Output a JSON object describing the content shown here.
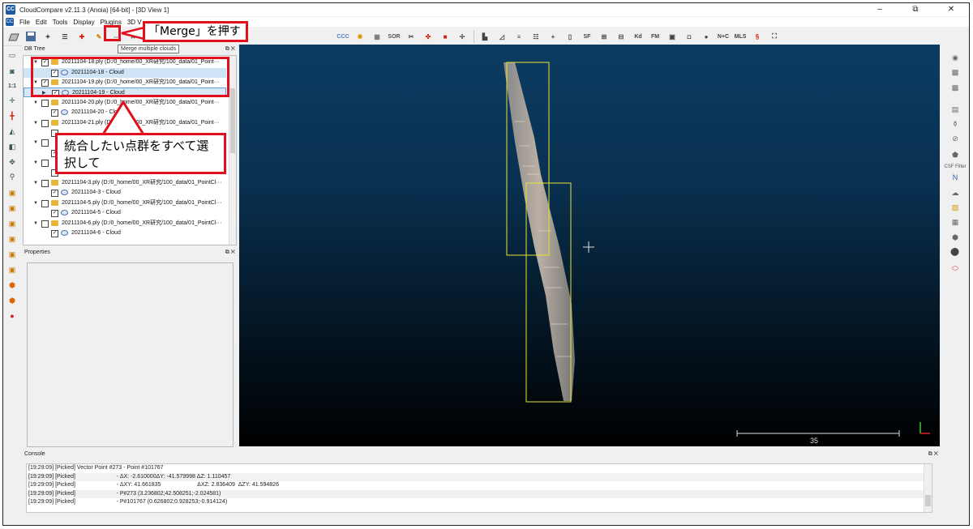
{
  "window": {
    "title": "CloudCompare v2.11.3 (Anoia) [64-bit] - [3D View 1]",
    "controls": [
      "–",
      "⧉",
      "✕"
    ]
  },
  "menu": {
    "items": [
      "File",
      "Edit",
      "Tools",
      "Display",
      "Plugins",
      "3D V"
    ]
  },
  "toolbar": {
    "tooltip": "Merge multiple clouds",
    "callout": "「Merge」を押す",
    "sor_label": "SOR",
    "sf_label": "SF",
    "kd_label": "Kd",
    "fm_label": "FM",
    "nc_label": "N+C",
    "mls_label": "MLS",
    "ccc_label": "CCC"
  },
  "db_tree": {
    "title": "DB Tree",
    "callout": "統合したい点群をすべて選択して",
    "rows": [
      {
        "text": "20211104-18.ply (D:/0_home/00_XR研究/100_data/01_Point···",
        "kind": "folder"
      },
      {
        "text": "20211104-18 - Cloud",
        "kind": "cloud"
      },
      {
        "text": "20211104-19.ply (D:/0_home/00_XR研究/100_data/01_Point···",
        "kind": "folder"
      },
      {
        "text": "20211104-19 - Cloud",
        "kind": "cloud"
      },
      {
        "text": "20211104-20.ply (D:/0_home/00_XR研究/100_data/01_Point···",
        "kind": "folder"
      },
      {
        "text": "20211104-20 - Cloud",
        "kind": "cloud"
      },
      {
        "text": "20211104-21.ply (D:/0_home/00_XR研究/100_data/01_Point···",
        "kind": "folder"
      },
      {
        "text": "20211104-3.ply (D:/0_home/00_XR研究/100_data/01_PointCl···",
        "kind": "folder"
      },
      {
        "text": "20211104-3 - Cloud",
        "kind": "cloud"
      },
      {
        "text": "20211104-5.ply (D:/0_home/00_XR研究/100_data/01_PointCl···",
        "kind": "folder"
      },
      {
        "text": "20211104-5 - Cloud",
        "kind": "cloud"
      },
      {
        "text": "20211104-6.ply (D:/0_home/00_XR研究/100_data/01_PointCl···",
        "kind": "folder"
      },
      {
        "text": "20211104-6 - Cloud",
        "kind": "cloud"
      }
    ]
  },
  "properties": {
    "title": "Properties"
  },
  "view3d": {
    "scale_label": "35"
  },
  "right_tools": {
    "csf_label": "CSF Filter"
  },
  "console": {
    "title": "Console",
    "lines": [
      "[19:29:09] [Picked] Vector Point #273 - Point #101767",
      "[19:29:09] [Picked]                          - ΔX: -2.610000ΔY: -41.579998 ΔZ: 1.110457",
      "[19:29:09] [Picked]                          - ΔXY: 41.661835                       ΔXZ: 2.836409  ΔZY: 41.594826",
      "[19:29:09] [Picked]                          - P#273 (3.236802;42.508251;-2.024581)",
      "[19:29:09] [Picked]                          - P#101767 (0.626802;0.928253;-0.914124)"
    ]
  }
}
